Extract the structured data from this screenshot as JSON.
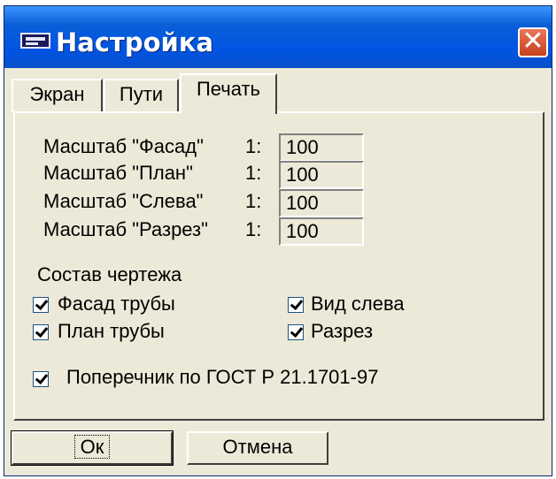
{
  "window": {
    "title": "Настройка",
    "close_glyph": "✕"
  },
  "tabs": [
    {
      "label": "Экран",
      "selected": false
    },
    {
      "label": "Пути",
      "selected": false
    },
    {
      "label": "Печать",
      "selected": true
    }
  ],
  "scales": [
    {
      "label": "Масштаб \"Фасад\"",
      "prefix": "1:",
      "value": "100"
    },
    {
      "label": "Масштаб \"План\"",
      "prefix": "1:",
      "value": "100"
    },
    {
      "label": "Масштаб \"Слева\"",
      "prefix": "1:",
      "value": "100"
    },
    {
      "label": "Масштаб \"Разрез\"",
      "prefix": "1:",
      "value": "100"
    }
  ],
  "composition": {
    "heading": "Состав чертежа",
    "items": [
      {
        "label": "Фасад трубы",
        "checked": true
      },
      {
        "label": "Вид слева",
        "checked": true
      },
      {
        "label": "План трубы",
        "checked": true
      },
      {
        "label": "Разрез",
        "checked": true
      }
    ]
  },
  "gost_option": {
    "label": "Поперечник по ГОСТ Р 21.1701-97",
    "checked": true
  },
  "buttons": {
    "ok": "Ок",
    "cancel": "Отмена"
  },
  "colors": {
    "titlebar": "#0054e3",
    "dialog_bg": "#ece9d8",
    "close": "#c7401b"
  }
}
